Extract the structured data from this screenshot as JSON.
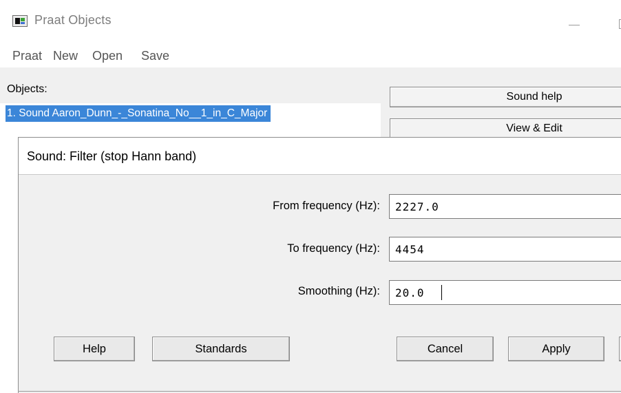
{
  "window": {
    "title": "Praat Objects",
    "icon": "praat-app-icon",
    "controls": [
      "minimize-icon",
      "maximize-icon"
    ]
  },
  "menubar": {
    "items": [
      "Praat",
      "New",
      "Open",
      "Save"
    ]
  },
  "objects": {
    "label": "Objects:",
    "items": [
      {
        "text": "1. Sound Aaron_Dunn_-_Sonatina_No__1_in_C_Major",
        "selected": true
      }
    ]
  },
  "side_buttons": [
    "Sound help",
    "View & Edit"
  ],
  "dialog": {
    "title": "Sound: Filter (stop Hann band)",
    "fields": [
      {
        "label": "From frequency (Hz):",
        "value": "2227.0"
      },
      {
        "label": "To frequency (Hz):",
        "value": "4454"
      },
      {
        "label": "Smoothing (Hz):",
        "value": "20.0"
      }
    ],
    "buttons": {
      "help": "Help",
      "standards": "Standards",
      "cancel": "Cancel",
      "apply": "Apply"
    }
  },
  "colors": {
    "selection": "#3b86d8",
    "window_bg": "#f0f0f0",
    "title_text": "#7d7d7d"
  }
}
